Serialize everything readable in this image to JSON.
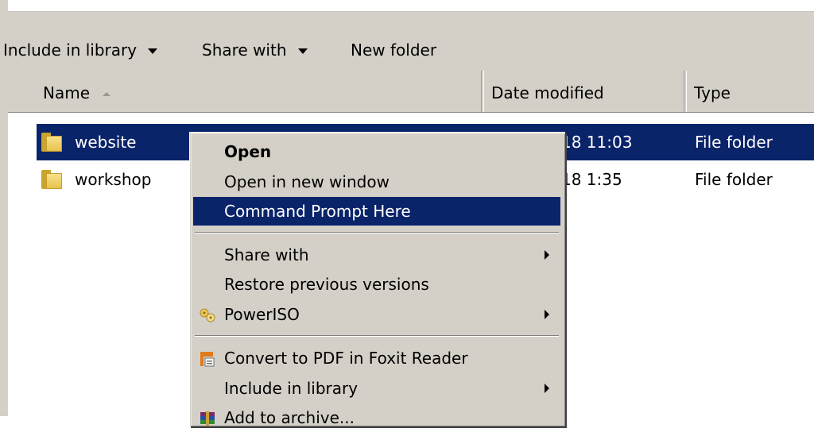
{
  "toolbar": {
    "include_in_library": "Include in library",
    "share_with": "Share with",
    "new_folder": "New folder"
  },
  "columns": {
    "name": "Name",
    "date_modified": "Date modified",
    "type": "Type"
  },
  "files": [
    {
      "name": "website",
      "date": "18 11:03",
      "type": "File folder",
      "selected": true
    },
    {
      "name": "workshop",
      "date": "18 1:35",
      "type": "File folder",
      "selected": false
    }
  ],
  "context_menu": {
    "open": "Open",
    "open_new_window": "Open in new window",
    "command_prompt": "Command Prompt Here",
    "share_with": "Share with",
    "restore_versions": "Restore previous versions",
    "poweriso": "PowerISO",
    "convert_pdf": "Convert to PDF in Foxit Reader",
    "include_in_library": "Include in library",
    "add_to_archive": "Add to archive..."
  },
  "colors": {
    "selection": "#0a246a",
    "chrome": "#d4d0c8"
  },
  "icons": [
    "folder-icon",
    "poweriso-icon",
    "foxit-pdf-icon",
    "winrar-archive-icon",
    "submenu-arrow-icon",
    "dropdown-arrow-icon",
    "sort-ascending-icon"
  ]
}
